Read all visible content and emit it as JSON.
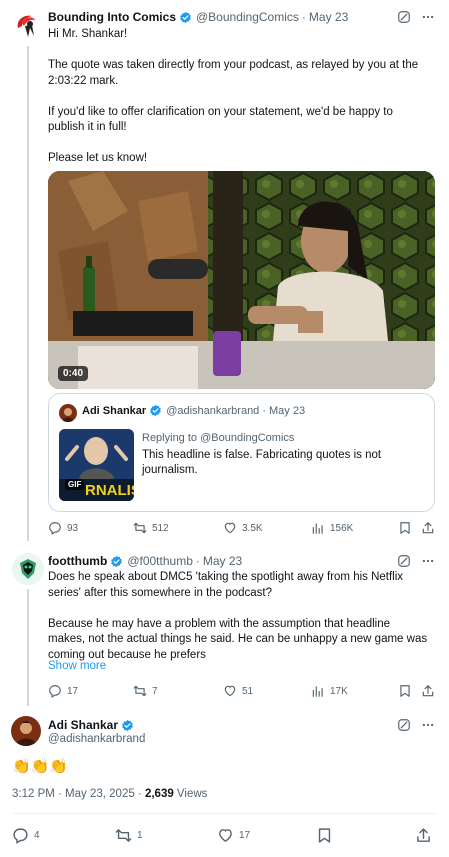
{
  "tweet1": {
    "name": "Bounding Into Comics",
    "handle": "@BoundingComics",
    "date": "May 23",
    "text": "Hi Mr. Shankar!\n\nThe quote was taken directly from your podcast, as relayed by you at the 2:03:22 mark.\n\nIf you'd like to offer clarification on your statement, we'd be happy to publish it in full!\n\nPlease let us know!",
    "video_time": "0:40",
    "quote": {
      "name": "Adi Shankar",
      "handle": "@adishankarbrand",
      "date": "May 23",
      "replying_to": "Replying to @BoundingComics",
      "text": "This headline is false. Fabricating quotes is not journalism.",
      "gif_badge": "GIF",
      "gif_caption": "RNALIS"
    },
    "stats": {
      "replies": "93",
      "reposts": "512",
      "likes": "3.5K",
      "views": "156K"
    }
  },
  "tweet2": {
    "name": "footthumb",
    "handle": "@f00tthumb",
    "date": "May 23",
    "text": "Does he speak about DMC5 'taking the spotlight away from his Netflix series' after this somewhere in the podcast?\n\nBecause he may have a problem with the assumption that headline makes, not the actual things he said. He can be unhappy a new game was coming out because he prefers",
    "show_more": "Show more",
    "stats": {
      "replies": "17",
      "reposts": "7",
      "likes": "51",
      "views": "17K"
    }
  },
  "main_tweet": {
    "name": "Adi Shankar",
    "handle": "@adishankarbrand",
    "text": "👏👏👏",
    "time": "3:12 PM · May 23, 2025 · ",
    "views_count": "2,639",
    "views_label": " Views",
    "stats": {
      "replies": "4",
      "reposts": "1",
      "likes": "17"
    }
  },
  "colors": {
    "verified": "#1d9bf0",
    "link": "#1d9bf0",
    "muted": "#536471",
    "border": "#cfd9de"
  },
  "icons": [
    "verified-icon",
    "grok-icon",
    "more-icon",
    "reply-icon",
    "repost-icon",
    "like-icon",
    "views-icon",
    "bookmark-icon",
    "share-icon"
  ]
}
